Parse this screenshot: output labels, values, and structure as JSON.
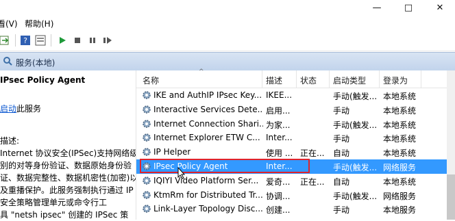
{
  "window": {
    "controls": [
      "—",
      "□",
      "✕"
    ]
  },
  "menu": {
    "items": [
      "看(V)",
      "帮助(H)"
    ]
  },
  "scope": {
    "title": "服务(本地)"
  },
  "left": {
    "service_title": "IPsec Policy Agent",
    "action_link": "启动",
    "action_suffix": "此服务",
    "desc_label": "描述:",
    "desc_body": "Internet 协议安全(IPSec)支持网络级\n别的对等身份验证、数据原始身份验\n证、数据完整性、数据机密性(加密)以\n及重播保护。此服务强制执行通过 IP\n安全策略管理单元或命令行工\n具 \"netsh ipsec\" 创建的 IPSec 策"
  },
  "columns": [
    "名称",
    "描述",
    "状态",
    "启动类型",
    "登录为"
  ],
  "services": [
    {
      "name": "IKE and AuthIP IPsec Key...",
      "desc": "IKEE...",
      "status": "",
      "startup": "手动(触发...",
      "logon": "本地系统"
    },
    {
      "name": "Interactive Services Dete...",
      "desc": "启用...",
      "status": "",
      "startup": "手动",
      "logon": "本地系统"
    },
    {
      "name": "Internet Connection Shari...",
      "desc": "为家...",
      "status": "",
      "startup": "手动(触发...",
      "logon": "本地系统"
    },
    {
      "name": "Internet Explorer ETW C...",
      "desc": "Inter...",
      "status": "",
      "startup": "手动",
      "logon": "本地系统"
    },
    {
      "name": "IP Helper",
      "desc": "使用 ...",
      "status": "正在...",
      "startup": "自动",
      "logon": "本地系统"
    },
    {
      "name": "IPsec Policy Agent",
      "desc": "Inter...",
      "status": "",
      "startup": "手动(触发...",
      "logon": "网络服务"
    },
    {
      "name": "IQIYI Video Platform Ser...",
      "desc": "爱奇...",
      "status": "正在...",
      "startup": "自动",
      "logon": "本地系统"
    },
    {
      "name": "KtmRm for Distributed Tr...",
      "desc": "协调...",
      "status": "",
      "startup": "手动(触发...",
      "logon": "网络服务"
    },
    {
      "name": "Link-Layer Topology Disc...",
      "desc": "创建...",
      "status": "",
      "startup": "手动",
      "logon": "本地服务"
    }
  ],
  "colors": {
    "selection": "#3399ff",
    "highlight_box": "#e0232b",
    "link": "#0b57d0"
  }
}
